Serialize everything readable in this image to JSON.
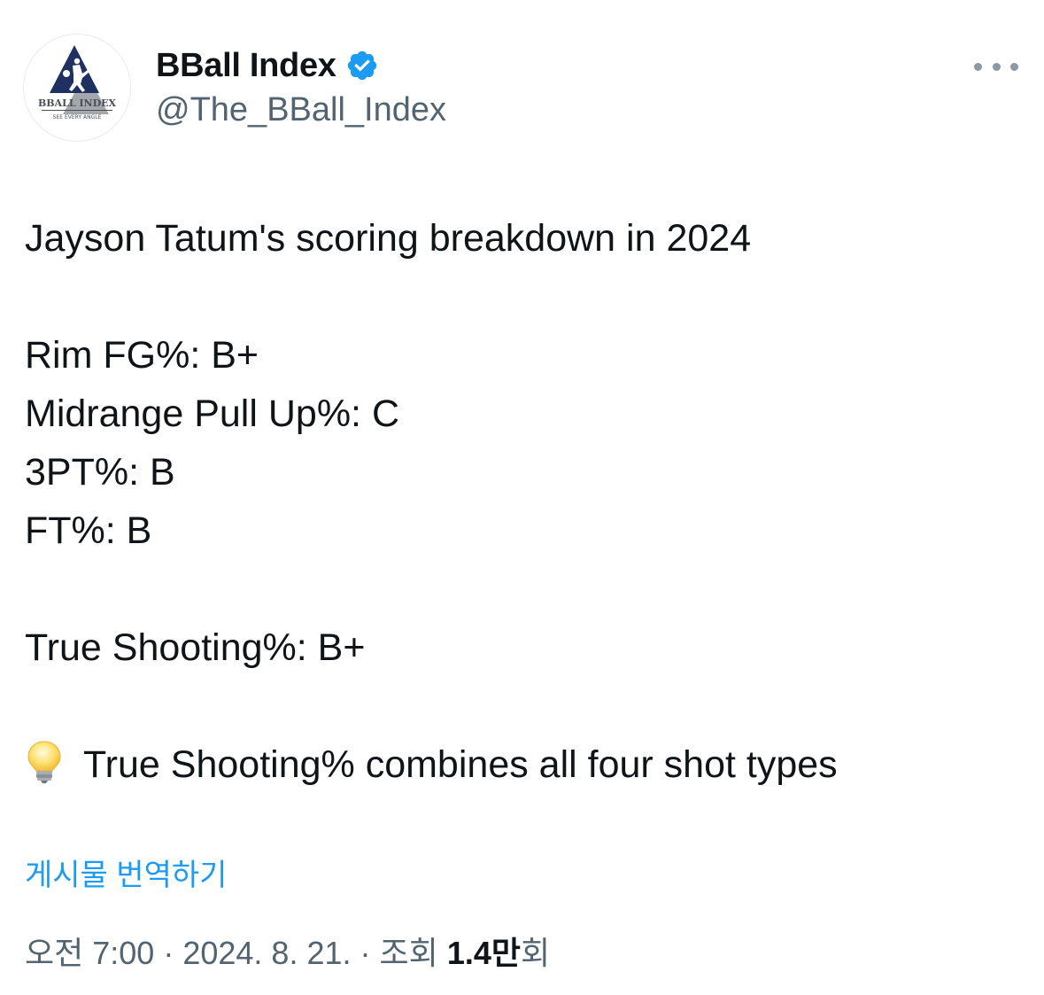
{
  "author": {
    "display_name": "BBall Index",
    "handle": "@The_BBall_Index",
    "verified": true,
    "avatar_icon": "bball-index-logo",
    "avatar_logo_text": "BBALL INDEX",
    "avatar_logo_tagline": "SEE EVERY ANGLE"
  },
  "tweet": {
    "lines": [
      "Jayson Tatum's scoring breakdown in 2024",
      "",
      "Rim FG%: B+",
      "Midrange Pull Up%: C",
      "3PT%: B",
      "FT%: B",
      "",
      "True Shooting%: B+",
      "",
      "True Shooting% combines all four shot types"
    ],
    "note_icon": "light-bulb-icon"
  },
  "translate_label": "게시물 번역하기",
  "meta": {
    "time": "오전 7:00",
    "date": "2024. 8. 21.",
    "views_label": "조회",
    "views_count": "1.4",
    "views_unit": "만",
    "views_suffix": "회",
    "separator": "·"
  },
  "colors": {
    "accent": "#1d9bf0",
    "text": "#0f1419",
    "secondary": "#536471",
    "logo_navy": "#1e3160",
    "logo_gray": "#a4a8ad"
  }
}
